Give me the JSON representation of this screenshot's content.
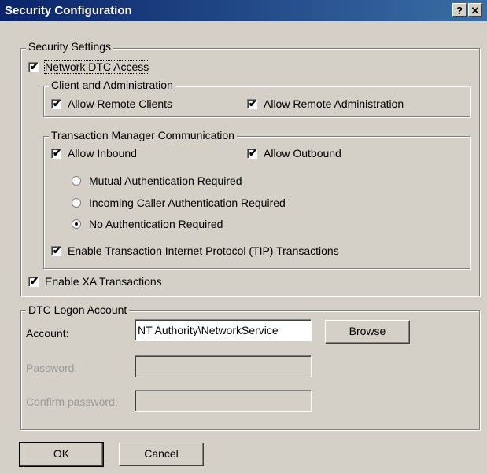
{
  "window": {
    "title": "Security Configuration",
    "help_glyph": "?",
    "close_glyph": "✕"
  },
  "security_settings": {
    "group_label": "Security Settings",
    "network_dtc_access": {
      "label": "Network DTC Access",
      "checked": true
    },
    "client_admin": {
      "group_label": "Client and Administration",
      "allow_remote_clients": {
        "label": "Allow Remote Clients",
        "checked": true
      },
      "allow_remote_administration": {
        "label": "Allow Remote Administration",
        "checked": true
      }
    },
    "tm_communication": {
      "group_label": "Transaction Manager Communication",
      "allow_inbound": {
        "label": "Allow Inbound",
        "checked": true
      },
      "allow_outbound": {
        "label": "Allow Outbound",
        "checked": true
      },
      "radios": [
        {
          "label": "Mutual Authentication Required",
          "selected": false
        },
        {
          "label": "Incoming Caller Authentication Required",
          "selected": false
        },
        {
          "label": "No Authentication Required",
          "selected": true
        }
      ],
      "enable_tip": {
        "label": "Enable Transaction Internet Protocol (TIP) Transactions",
        "checked": true
      }
    },
    "enable_xa": {
      "label": "Enable XA Transactions",
      "checked": true
    }
  },
  "logon_account": {
    "group_label": "DTC Logon Account",
    "account_label": "Account:",
    "account_value": "NT Authority\\NetworkService",
    "browse_label": "Browse",
    "password_label": "Password:",
    "password_value": "",
    "confirm_label": "Confirm password:",
    "confirm_value": ""
  },
  "buttons": {
    "ok_label": "OK",
    "cancel_label": "Cancel"
  },
  "check_glyph": "✔",
  "colors": {
    "title_start": "#0a246a",
    "title_end": "#3a6ea5",
    "face": "#d4d0c8"
  }
}
